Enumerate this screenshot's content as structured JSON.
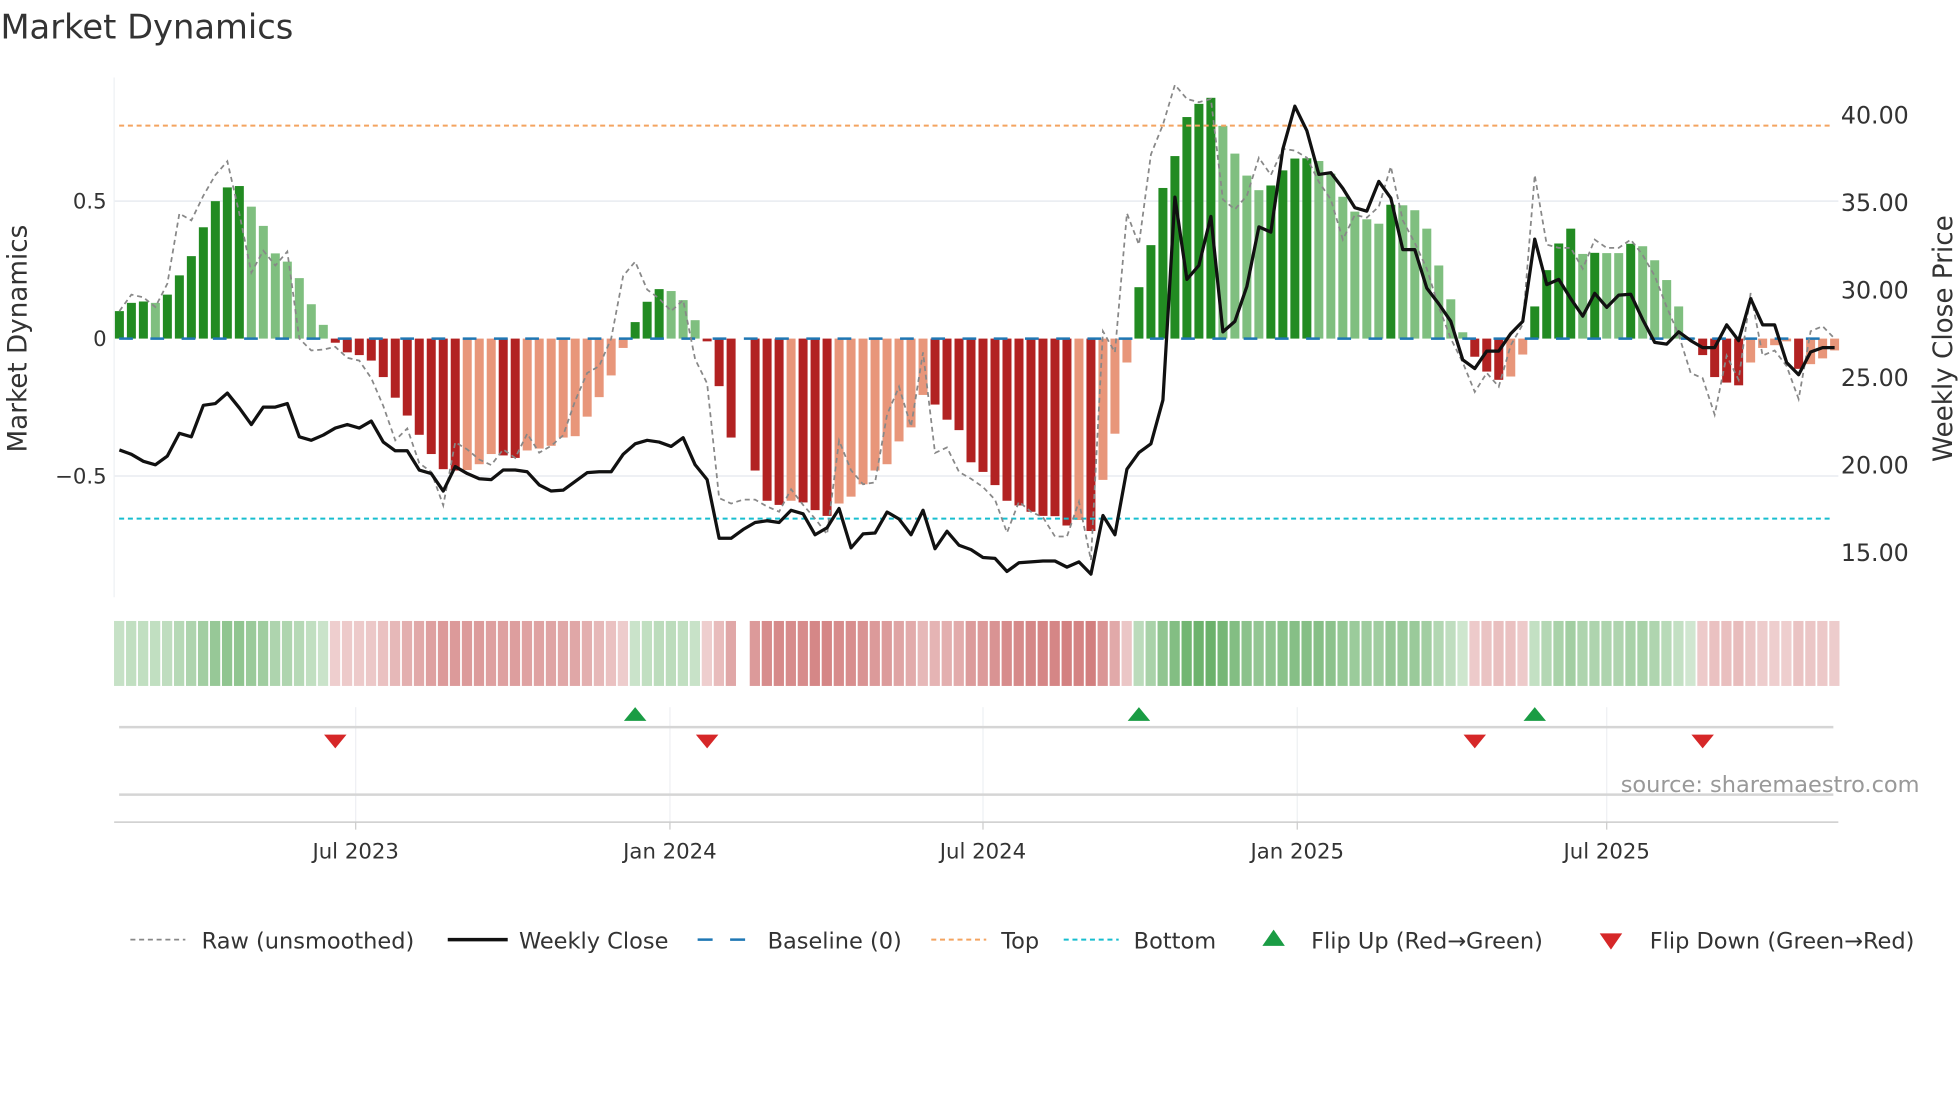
{
  "title": "Market Dynamics",
  "source": "source: sharemaestro.com",
  "colors": {
    "up_pos": "#228b22",
    "down_pos": "#7fbf7f",
    "down_neg": "#b22222",
    "up_neg": "#e8967a",
    "close": "#111111",
    "raw": "#888888",
    "baseline": "#1f77b4",
    "top": "#f4a460",
    "bottom": "#17becf",
    "flip_up": "#1a9c44",
    "flip_down": "#d62728"
  },
  "chart_data": {
    "type": "bar",
    "title": "Market Dynamics",
    "ylabel": "Market Dynamics",
    "y2label": "Weekly Close Price",
    "ylim": [
      -0.95,
      0.95
    ],
    "y2lim": [
      12.5,
      42.5
    ],
    "yticks": [
      {
        "v": 0.5,
        "label": "0.5"
      },
      {
        "v": 0,
        "label": "0"
      },
      {
        "v": -0.5,
        "label": "−0.5"
      }
    ],
    "y2ticks": [
      {
        "v": 40,
        "label": "40.00"
      },
      {
        "v": 35,
        "label": "35.00"
      },
      {
        "v": 30,
        "label": "30.00"
      },
      {
        "v": 25,
        "label": "25.00"
      },
      {
        "v": 20,
        "label": "20.00"
      },
      {
        "v": 15,
        "label": "15.00"
      }
    ],
    "xticks": [
      {
        "x": 19.7,
        "label": "Jul 2023"
      },
      {
        "x": 45.9,
        "label": "Jan 2024"
      },
      {
        "x": 72.0,
        "label": "Jul 2024"
      },
      {
        "x": 98.2,
        "label": "Jan 2025"
      },
      {
        "x": 124.0,
        "label": "Jul 2025"
      }
    ],
    "baseline": 0,
    "top": 0.775,
    "bottom": -0.655,
    "histogram": [
      0.1,
      0.13,
      0.135,
      0.13,
      0.16,
      0.23,
      0.3,
      0.405,
      0.5,
      0.55,
      0.555,
      0.48,
      0.41,
      0.31,
      0.28,
      0.22,
      0.125,
      0.05,
      -0.015,
      -0.05,
      -0.06,
      -0.08,
      -0.14,
      -0.215,
      -0.28,
      -0.35,
      -0.42,
      -0.475,
      -0.48,
      -0.478,
      -0.457,
      -0.42,
      -0.425,
      -0.434,
      -0.407,
      -0.4,
      -0.39,
      -0.36,
      -0.355,
      -0.284,
      -0.213,
      -0.134,
      -0.034,
      0.06,
      0.134,
      0.18,
      0.173,
      0.14,
      0.067,
      -0.01,
      -0.173,
      -0.36,
      null,
      -0.48,
      -0.59,
      -0.605,
      -0.59,
      -0.596,
      -0.624,
      -0.645,
      -0.6,
      -0.575,
      -0.53,
      -0.48,
      -0.457,
      -0.374,
      -0.323,
      -0.205,
      -0.24,
      -0.295,
      -0.333,
      -0.45,
      -0.485,
      -0.533,
      -0.59,
      -0.607,
      -0.63,
      -0.645,
      -0.646,
      -0.68,
      -0.66,
      -0.7,
      -0.514,
      -0.346,
      -0.087,
      0.187,
      0.34,
      0.548,
      0.664,
      0.806,
      0.854,
      0.876,
      0.774,
      0.673,
      0.593,
      0.54,
      0.557,
      0.612,
      0.655,
      0.656,
      0.646,
      0.6,
      0.516,
      0.462,
      0.434,
      0.418,
      0.487,
      0.485,
      0.467,
      0.4,
      0.266,
      0.143,
      0.023,
      -0.066,
      -0.12,
      -0.15,
      -0.138,
      -0.058,
      0.117,
      0.249,
      0.346,
      0.4,
      0.308,
      0.312,
      0.311,
      0.311,
      0.345,
      0.336,
      0.285,
      0.213,
      0.117,
      0.003,
      -0.06,
      -0.14,
      -0.16,
      -0.17,
      -0.087,
      -0.034,
      -0.024,
      -0.01,
      -0.11,
      -0.093,
      -0.072,
      -0.043
    ],
    "raw": [
      0.1,
      0.16,
      0.15,
      0.115,
      0.2,
      0.455,
      0.43,
      0.52,
      0.595,
      0.645,
      0.455,
      0.24,
      0.32,
      0.266,
      0.317,
      0.0,
      -0.043,
      -0.04,
      -0.03,
      -0.07,
      -0.08,
      -0.144,
      -0.245,
      -0.37,
      -0.327,
      -0.453,
      -0.485,
      -0.607,
      -0.377,
      -0.403,
      -0.44,
      -0.46,
      -0.403,
      -0.434,
      -0.346,
      -0.415,
      -0.39,
      -0.352,
      -0.226,
      -0.125,
      -0.1,
      0.0,
      0.228,
      0.28,
      0.178,
      0.146,
      0.1,
      0.14,
      -0.075,
      -0.163,
      -0.58,
      -0.6,
      -0.586,
      -0.586,
      -0.611,
      -0.63,
      -0.548,
      -0.605,
      -0.655,
      -0.712,
      -0.371,
      -0.479,
      -0.53,
      -0.523,
      -0.277,
      -0.175,
      -0.32,
      -0.05,
      -0.416,
      -0.396,
      -0.485,
      -0.51,
      -0.54,
      -0.586,
      -0.706,
      -0.593,
      -0.63,
      -0.65,
      -0.72,
      -0.72,
      -0.593,
      -0.806,
      0.027,
      -0.05,
      0.456,
      0.342,
      0.67,
      0.778,
      0.923,
      0.872,
      0.86,
      0.872,
      0.506,
      0.47,
      0.52,
      0.658,
      0.595,
      0.69,
      0.684,
      0.658,
      0.57,
      0.506,
      0.36,
      0.45,
      0.44,
      0.48,
      0.626,
      0.43,
      0.348,
      0.254,
      0.115,
      0.0,
      -0.087,
      -0.194,
      -0.125,
      -0.175,
      -0.024,
      0.052,
      0.595,
      0.342,
      0.33,
      0.33,
      0.254,
      0.36,
      0.33,
      0.33,
      0.36,
      0.304,
      0.228,
      0.115,
      0.014,
      -0.125,
      -0.144,
      -0.277,
      -0.062,
      -0.15,
      0.166,
      -0.062,
      -0.043,
      -0.1,
      -0.22,
      0.027,
      0.045,
      0.0
    ],
    "close": [
      20.85,
      20.6,
      20.2,
      20.0,
      20.5,
      21.8,
      21.6,
      23.4,
      23.5,
      24.1,
      23.25,
      22.3,
      23.3,
      23.3,
      23.5,
      21.6,
      21.4,
      21.7,
      22.1,
      22.3,
      22.1,
      22.5,
      21.3,
      20.8,
      20.8,
      19.7,
      19.5,
      18.5,
      19.9,
      19.5,
      19.2,
      19.15,
      19.7,
      19.7,
      19.6,
      18.85,
      18.5,
      18.55,
      19.05,
      19.55,
      19.6,
      19.6,
      20.6,
      21.2,
      21.4,
      21.3,
      21.05,
      21.55,
      20.0,
      19.15,
      15.8,
      15.8,
      16.3,
      16.7,
      16.8,
      16.7,
      17.4,
      17.2,
      16.0,
      16.4,
      17.5,
      15.25,
      16.05,
      16.1,
      17.3,
      16.9,
      16.0,
      17.4,
      15.2,
      16.2,
      15.4,
      15.15,
      14.7,
      14.65,
      13.9,
      14.4,
      14.45,
      14.5,
      14.5,
      14.15,
      14.45,
      13.75,
      17.1,
      16.0,
      19.75,
      20.7,
      21.2,
      23.7,
      35.3,
      30.6,
      31.4,
      34.2,
      27.6,
      28.2,
      30.2,
      33.6,
      33.3,
      38.05,
      40.5,
      39.1,
      36.6,
      36.7,
      35.8,
      34.7,
      34.5,
      36.2,
      35.25,
      32.3,
      32.3,
      30.1,
      29.2,
      28.2,
      26.0,
      25.5,
      26.5,
      26.5,
      27.5,
      28.2,
      32.9,
      30.3,
      30.6,
      29.5,
      28.5,
      29.8,
      29.0,
      29.7,
      29.75,
      28.3,
      27.0,
      26.9,
      27.6,
      27.1,
      26.7,
      26.7,
      28.0,
      27.1,
      29.5,
      28.0,
      28.0,
      25.85,
      25.15,
      26.45,
      26.7,
      26.7
    ],
    "flips_up": [
      43,
      85,
      118
    ],
    "flips_down": [
      18,
      49,
      113,
      132
    ],
    "legend": {
      "placement": "bottom",
      "items": [
        {
          "key": "raw",
          "label": "Raw (unsmoothed)"
        },
        {
          "key": "close",
          "label": "Weekly Close"
        },
        {
          "key": "baseline",
          "label": "Baseline (0)"
        },
        {
          "key": "top",
          "label": "Top"
        },
        {
          "key": "bottom",
          "label": "Bottom"
        },
        {
          "key": "flip_up",
          "label": "Flip Up (Red→Green)"
        },
        {
          "key": "flip_down",
          "label": "Flip Down (Green→Red)"
        }
      ]
    }
  }
}
